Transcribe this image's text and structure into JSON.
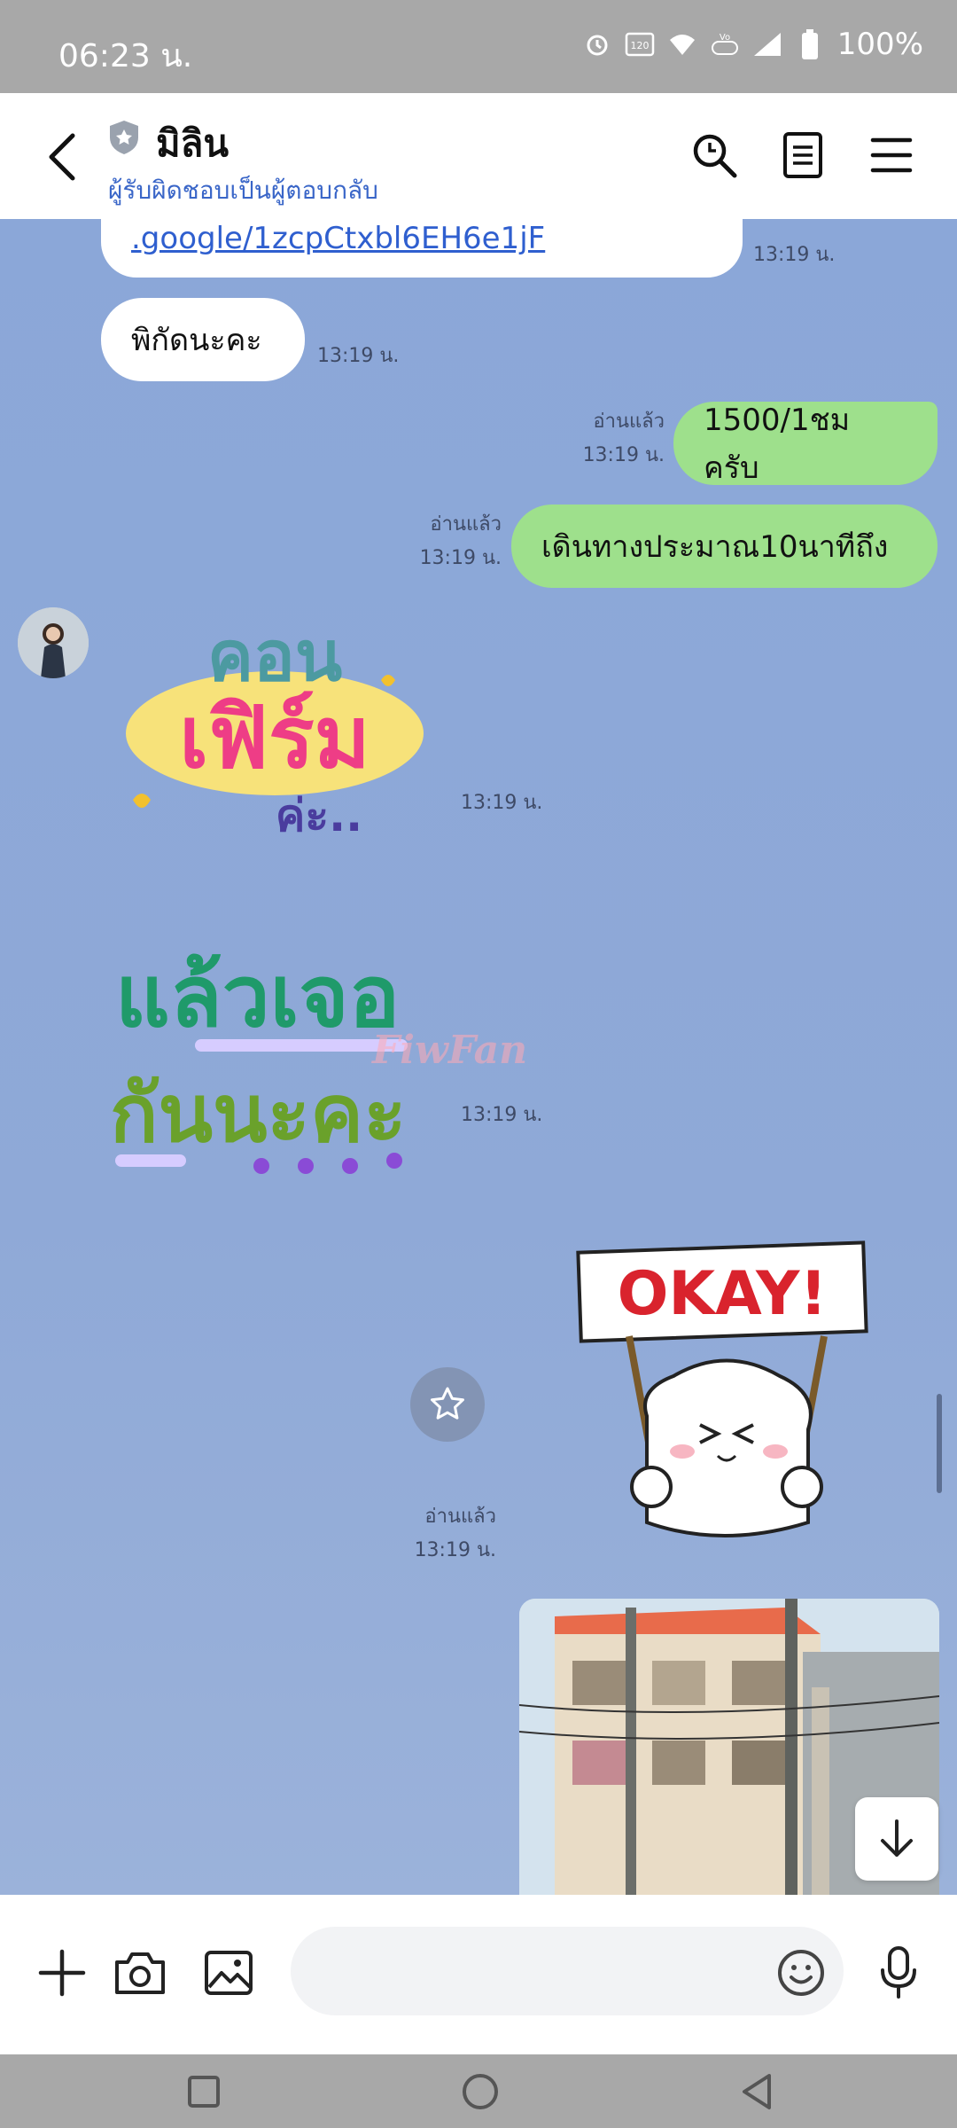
{
  "status_bar": {
    "time": "06:23 น.",
    "battery": "100%",
    "icons": [
      "alarm-icon",
      "hd-120-icon",
      "wifi-icon",
      "volte-icon",
      "signal-icon",
      "battery-icon"
    ]
  },
  "header": {
    "contact_name": "มิลิน",
    "subtitle": "ผู้รับผิดชอบเป็นผู้ตอบกลับ",
    "icons": [
      "back-arrow-icon",
      "shield-icon",
      "search-icon",
      "notes-icon",
      "menu-icon"
    ]
  },
  "messages": {
    "link_text": ".google/1zcpCtxbl6EH6e1jF",
    "link_time": "13:19 น.",
    "location_text": "พิกัดนะคะ",
    "location_time": "13:19 น.",
    "price": {
      "status": "อ่านแล้ว",
      "time": "13:19 น.",
      "text": "1500/1ชม ครับ"
    },
    "walk": {
      "status": "อ่านแล้ว",
      "time": "13:19 น.",
      "text": "เดินทางประมาณ10นาทีถึง"
    },
    "sticker_confirm": {
      "text_line1": "คอน",
      "text_line2": "เฟิร์ม",
      "text_line3": "ค่ะ..",
      "time": "13:19 น."
    },
    "sticker_see_you": {
      "text_line1": "แล้วเจอ",
      "text_line2": "กันนะคะ",
      "time": "13:19 น."
    },
    "sticker_okay": {
      "sign_text": "OKAY!",
      "status": "อ่านแล้ว",
      "time": "13:19 น."
    },
    "watermark": "FiwFan"
  },
  "colors": {
    "chat_bg": "#8aa6d6",
    "my_bubble": "#9ee08c",
    "their_bubble": "#ffffff",
    "link": "#2f5fcf",
    "header_subtitle": "#3a66c8"
  }
}
